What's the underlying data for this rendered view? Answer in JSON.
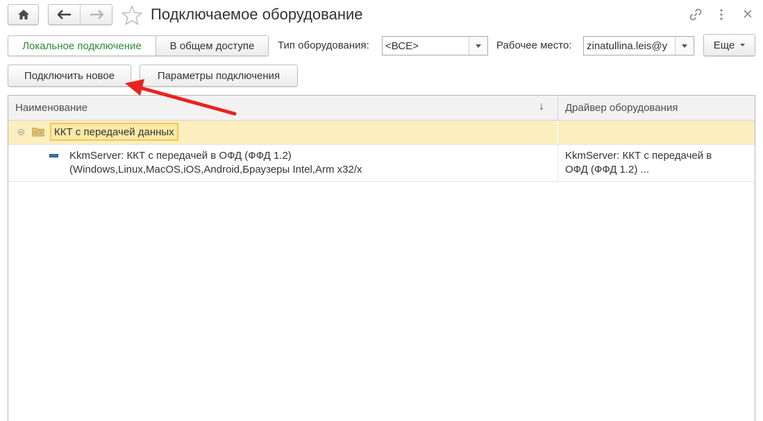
{
  "window": {
    "title": "Подключаемое оборудование",
    "icons": [
      "home-icon",
      "back-arrow-icon",
      "forward-arrow-icon",
      "favorite-star-icon",
      "link-icon",
      "more-vertical-icon",
      "close-icon"
    ]
  },
  "toolbar": {
    "mode_local": "Локальное подключение",
    "mode_shared": "В общем доступе",
    "equipment_type_label": "Тип оборудования:",
    "equipment_type_value": "<ВСЕ>",
    "workplace_label": "Рабочее место:",
    "workplace_value": "zinatullina.leis@y",
    "more_label": "Еще"
  },
  "actions": {
    "connect_new": "Подключить новое",
    "connection_params": "Параметры подключения"
  },
  "table": {
    "columns": [
      "Наименование",
      "Драйвер оборудования"
    ],
    "sort_indicator": "↓",
    "group": {
      "label": "ККТ с передачей данных"
    },
    "rows": [
      {
        "name_line1": "KkmServer: ККТ с передачей в ОФД (ФФД 1.2)",
        "name_line2": "(Windows,Linux,MacOS,iOS,Android,Браузеры Intel,Arm x32/x",
        "driver_line1": "KkmServer: ККТ с передачей в",
        "driver_line2": "ОФД (ФФД 1.2) ..."
      }
    ]
  },
  "colors": {
    "accent_active_text": "#2e8b3a",
    "group_row_bg": "#fbeebf",
    "group_label_border": "#f2c94c",
    "annotation_arrow": "#e8231f"
  }
}
